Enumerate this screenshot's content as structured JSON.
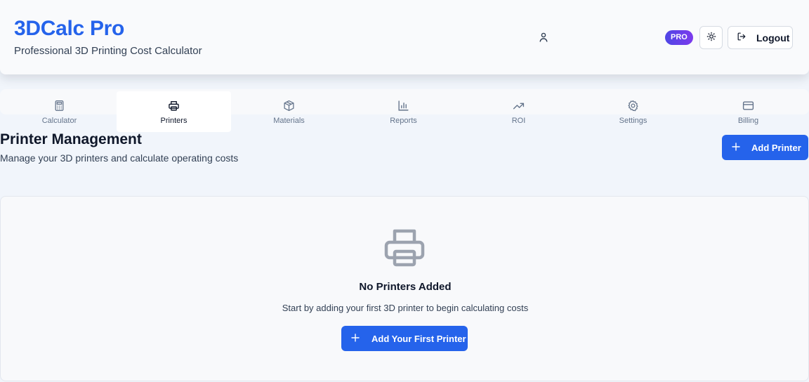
{
  "header": {
    "title": "3DCalc Pro",
    "subtitle": "Professional 3D Printing Cost Calculator",
    "user_icon": "user-icon",
    "badge": "PRO",
    "theme_icon": "sun-icon",
    "logout_label": "Logout",
    "logout_icon": "logout-icon"
  },
  "tabs": [
    {
      "label": "Calculator",
      "icon": "calculator-icon",
      "active": false
    },
    {
      "label": "Printers",
      "icon": "printer-icon",
      "active": true
    },
    {
      "label": "Materials",
      "icon": "box-icon",
      "active": false
    },
    {
      "label": "Reports",
      "icon": "bar-chart-icon",
      "active": false
    },
    {
      "label": "ROI",
      "icon": "trending-up-icon",
      "active": false
    },
    {
      "label": "Settings",
      "icon": "gear-icon",
      "active": false
    },
    {
      "label": "Billing",
      "icon": "credit-card-icon",
      "active": false
    }
  ],
  "page": {
    "title": "Printer Management",
    "subtitle": "Manage your 3D printers and calculate operating costs",
    "add_button": "Add Printer"
  },
  "empty_state": {
    "icon": "printer-icon",
    "title": "No Printers Added",
    "text": "Start by adding your first 3D printer to begin calculating costs",
    "button": "Add Your First Printer"
  },
  "colors": {
    "accent": "#2563eb",
    "badge_gradient_start": "#4f46e5",
    "badge_gradient_end": "#7c3aed"
  }
}
